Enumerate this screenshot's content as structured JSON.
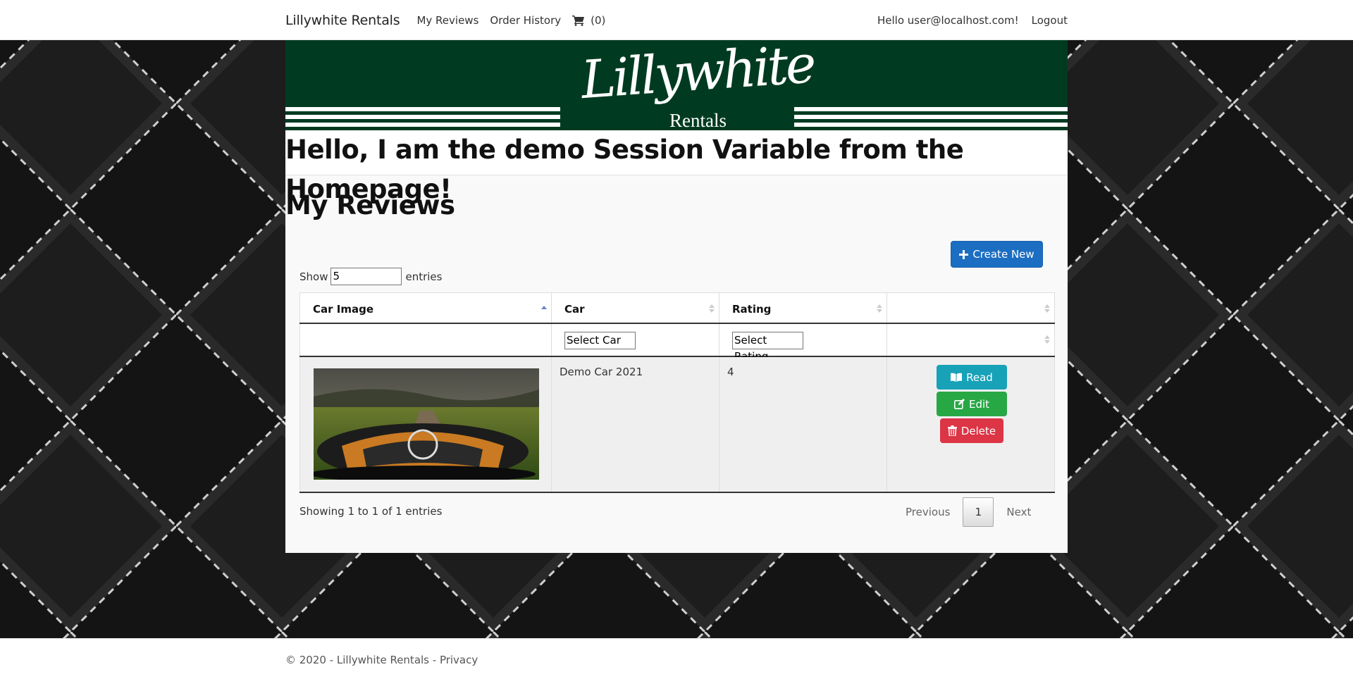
{
  "nav": {
    "brand": "Lillywhite Rentals",
    "links": [
      "My Reviews",
      "Order History"
    ],
    "cart_count": "(0)",
    "greeting": "Hello user@localhost.com!",
    "logout": "Logout"
  },
  "banner": {
    "logo_script": "Lillywhite",
    "logo_sub": "Rentals"
  },
  "session_message": "Hello, I am the demo Session Variable from the Homepage!",
  "page_title": "My Reviews",
  "create_button": "Create New",
  "length": {
    "show_label": "Show",
    "value": "5",
    "entries_label": "entries"
  },
  "table": {
    "headers": [
      "Car Image",
      "Car",
      "Rating",
      ""
    ],
    "filters": {
      "car": "Select Car",
      "rating": "Select Rating"
    },
    "rows": [
      {
        "car": "Demo Car 2021",
        "rating": "4"
      }
    ],
    "actions": {
      "read": "Read",
      "edit": "Edit",
      "delete": "Delete"
    }
  },
  "info": "Showing 1 to 1 of 1 entries",
  "pagination": {
    "previous": "Previous",
    "current": "1",
    "next": "Next"
  },
  "footer": {
    "copyright": "© 2020 - Lillywhite Rentals - ",
    "privacy": "Privacy"
  },
  "colors": {
    "banner_green": "#003b21",
    "primary": "#1b6ec2",
    "info": "#17a2b8",
    "success": "#28a745",
    "danger": "#dc3545"
  },
  "icons": {
    "cart": "shopping-cart-icon",
    "create": "plus-icon",
    "read": "book-icon",
    "edit": "edit-icon",
    "delete": "trash-icon"
  }
}
